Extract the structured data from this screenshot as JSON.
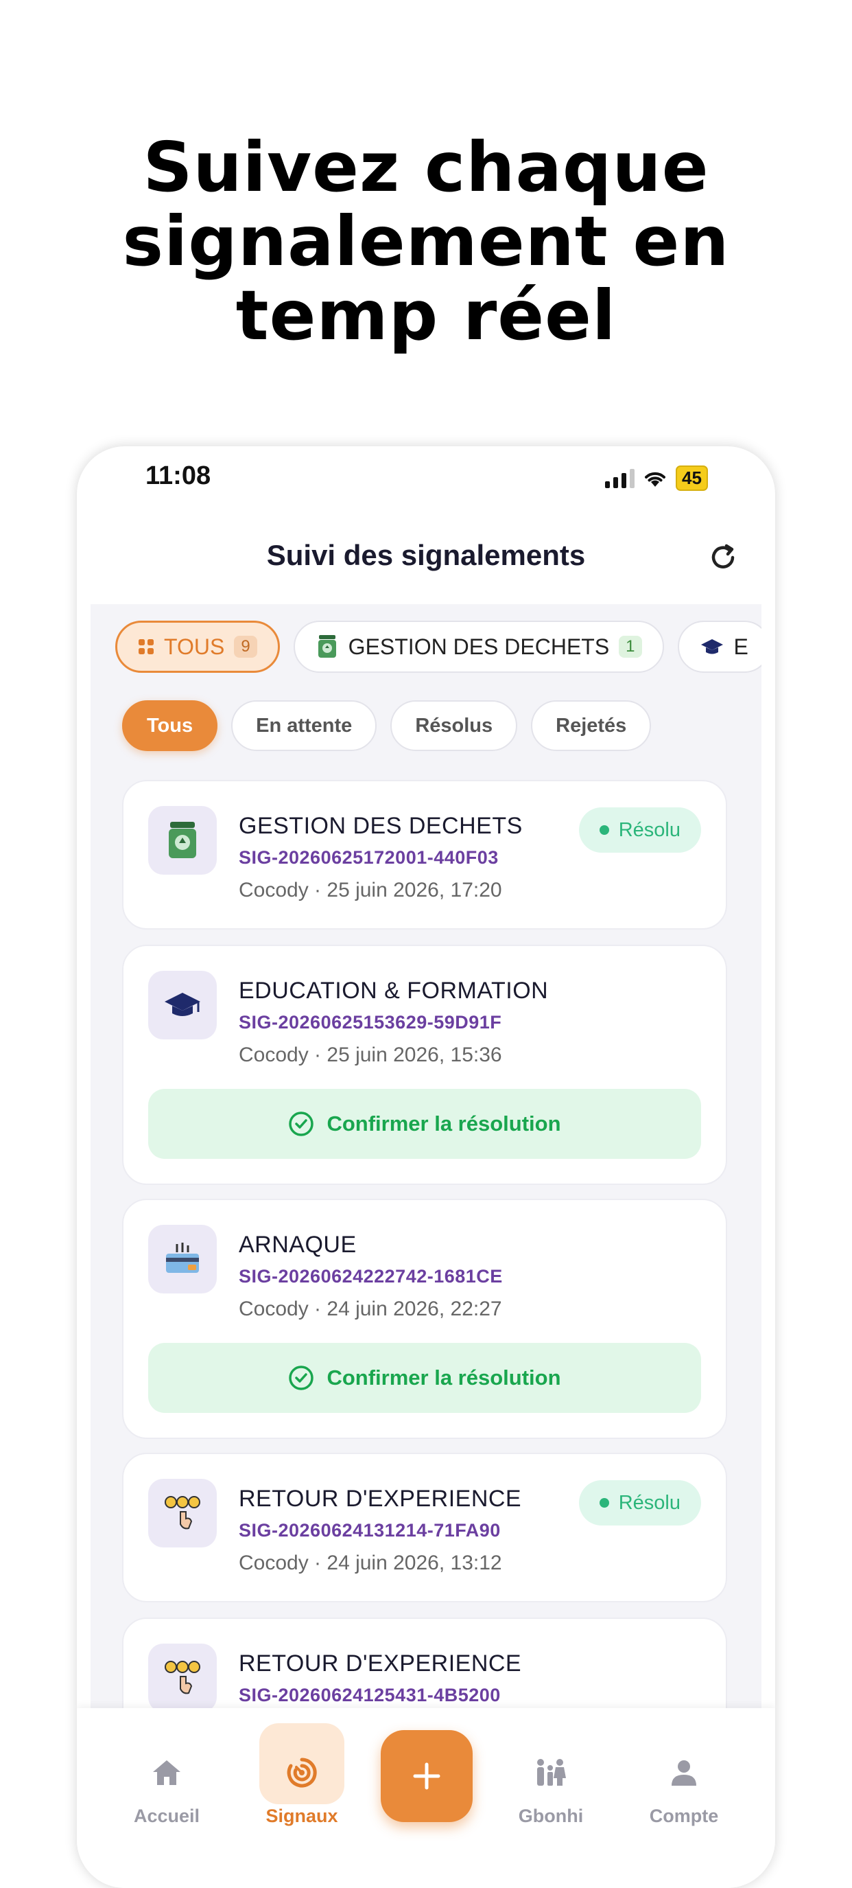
{
  "headline": {
    "line1": "Suivez chaque",
    "line2": "signalement en",
    "line3": "temp réel"
  },
  "status": {
    "time": "11:08",
    "battery": "45"
  },
  "appbar": {
    "title": "Suivi des signalements"
  },
  "category_chips": [
    {
      "label": "TOUS",
      "count": "9"
    },
    {
      "label": "GESTION DES DECHETS",
      "count": "1"
    },
    {
      "label": "E"
    }
  ],
  "status_filters": [
    "Tous",
    "En attente",
    "Résolus",
    "Rejetés"
  ],
  "reports": [
    {
      "category": "GESTION DES DECHETS",
      "reference": "SIG-20260625172001-440F03",
      "meta": "Cocody · 25 juin 2026, 17:20",
      "badge": "Résolu",
      "icon": "trash-bin-icon"
    },
    {
      "category": "EDUCATION & FORMATION",
      "reference": "SIG-20260625153629-59D91F",
      "meta": "Cocody · 25 juin 2026, 15:36",
      "action": "Confirmer la résolution",
      "icon": "graduation-cap-icon"
    },
    {
      "category": "ARNAQUE",
      "reference": "SIG-20260624222742-1681CE",
      "meta": "Cocody · 24 juin 2026, 22:27",
      "action": "Confirmer la résolution",
      "icon": "card-scam-icon"
    },
    {
      "category": "RETOUR D'EXPERIENCE",
      "reference": "SIG-20260624131214-71FA90",
      "meta": "Cocody · 24 juin 2026, 13:12",
      "badge": "Résolu",
      "icon": "feedback-icon"
    },
    {
      "category": "RETOUR D'EXPERIENCE",
      "reference": "SIG-20260624125431-4B5200",
      "icon": "feedback-icon"
    }
  ],
  "nav": [
    {
      "label": "Accueil",
      "icon": "home-icon"
    },
    {
      "label": "Signaux",
      "icon": "signal-icon"
    },
    {
      "label": "Gbonhi",
      "icon": "family-icon"
    },
    {
      "label": "Compte",
      "icon": "user-icon"
    }
  ],
  "colors": {
    "accent": "#e98a3a",
    "success": "#19a64e",
    "reference": "#6b3fa0"
  }
}
